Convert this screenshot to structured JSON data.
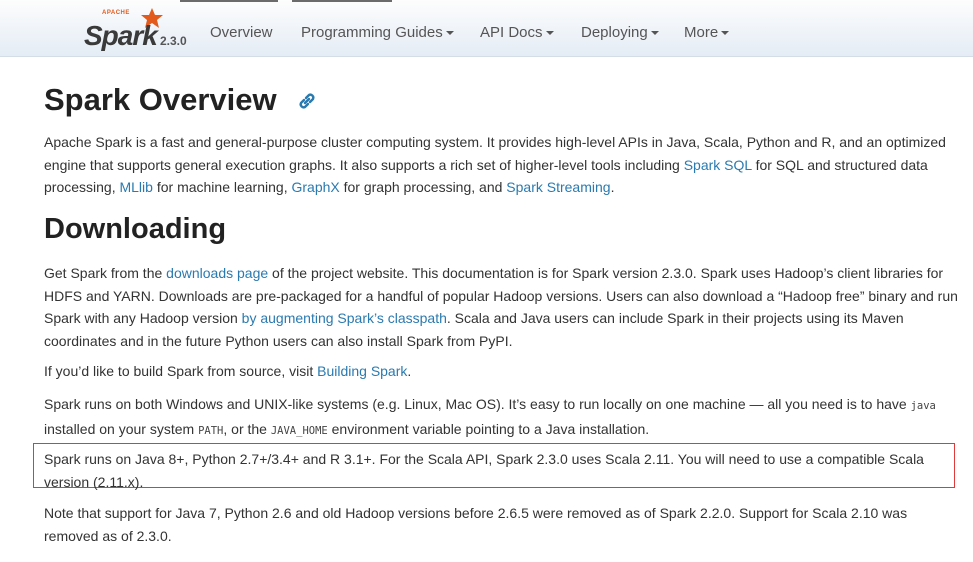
{
  "nav": {
    "brand": {
      "apache": "APACHE",
      "word": "Spark",
      "version": "2.3.0"
    },
    "items": [
      {
        "label": "Overview",
        "dropdown": false
      },
      {
        "label": "Programming Guides",
        "dropdown": true
      },
      {
        "label": "API Docs",
        "dropdown": true
      },
      {
        "label": "Deploying",
        "dropdown": true
      },
      {
        "label": "More",
        "dropdown": true
      }
    ]
  },
  "page": {
    "title": "Spark Overview",
    "intro": {
      "t1": "Apache Spark is a fast and general-purpose cluster computing system. It provides high-level APIs in Java, Scala, Python and R, and an optimized engine that supports general execution graphs. It also supports a rich set of higher-level tools including ",
      "link1": "Spark SQL",
      "t2": " for SQL and structured data processing, ",
      "link2": "MLlib",
      "t3": " for machine learning, ",
      "link3": "GraphX",
      "t4": " for graph processing, and ",
      "link4": "Spark Streaming",
      "t5": "."
    },
    "downloading": {
      "heading": "Downloading",
      "p1": {
        "t1": "Get Spark from the ",
        "link1": "downloads page",
        "t2": " of the project website. This documentation is for Spark version 2.3.0. Spark uses Hadoop’s client libraries for HDFS and YARN. Downloads are pre-packaged for a handful of popular Hadoop versions. Users can also download a “Hadoop free” binary and run Spark with any Hadoop version ",
        "link2": "by augmenting Spark’s classpath",
        "t3": ". Scala and Java users can include Spark in their projects using its Maven coordinates and in the future Python users can also install Spark from PyPI."
      },
      "p2": {
        "t1": "If you’d like to build Spark from source, visit ",
        "link1": "Building Spark",
        "t2": "."
      },
      "p3": {
        "t1": "Spark runs on both Windows and UNIX-like systems (e.g. Linux, Mac OS). It’s easy to run locally on one machine — all you need is to have ",
        "code1": "java",
        "t2": " installed on your system ",
        "code2": "PATH",
        "t3": ", or the ",
        "code3": "JAVA_HOME",
        "t4": " environment variable pointing to a Java installation."
      },
      "p4": "Spark runs on Java 8+, Python 2.7+/3.4+ and R 3.1+. For the Scala API, Spark 2.3.0 uses Scala 2.11. You will need to use a compatible Scala version (2.11.x).",
      "p5": "Note that support for Java 7, Python 2.6 and old Hadoop versions before 2.6.5 were removed as of Spark 2.2.0. Support for Scala 2.10 was removed as of 2.3.0."
    }
  },
  "colors": {
    "link": "#2a7ab0",
    "highlight_border": "#e03a3a",
    "brand_star": "#e25a1c"
  }
}
